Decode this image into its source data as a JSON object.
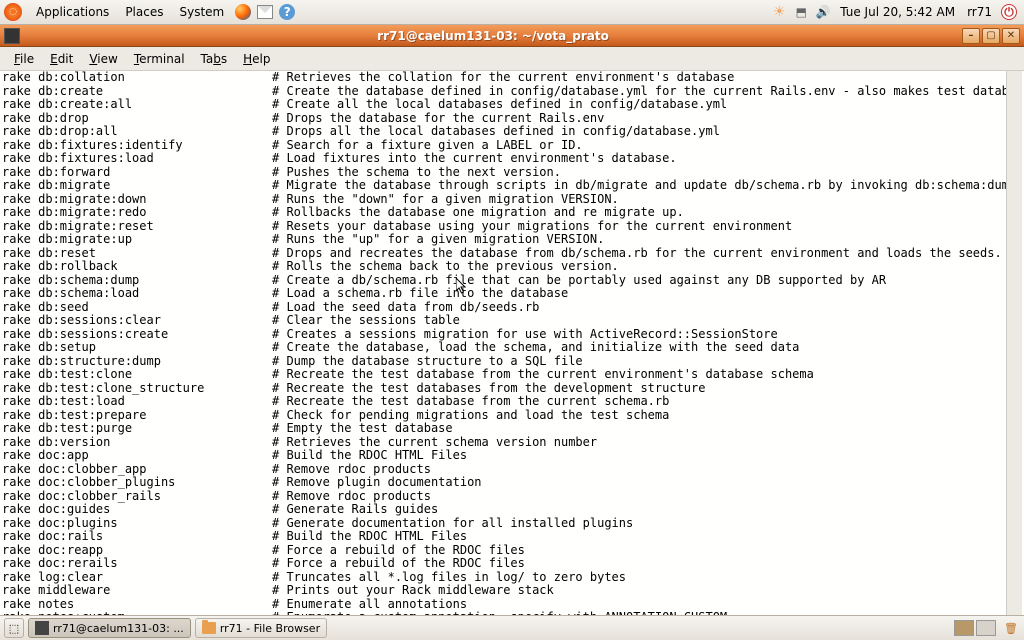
{
  "top_panel": {
    "menus": [
      "Applications",
      "Places",
      "System"
    ],
    "clock": "Tue Jul 20,  5:42 AM",
    "user": "rr71"
  },
  "window": {
    "title": "rr71@caelum131-03: ~/vota_prato",
    "menubar": [
      {
        "ul": "F",
        "rest": "ile"
      },
      {
        "ul": "E",
        "rest": "dit"
      },
      {
        "ul": "V",
        "rest": "iew"
      },
      {
        "ul": "T",
        "rest": "erminal"
      },
      {
        "ul": "",
        "rest": "Ta",
        "ul2": "b",
        "rest2": "s"
      },
      {
        "ul": "H",
        "rest": "elp"
      }
    ]
  },
  "terminal_lines": [
    {
      "cmd": "rake db:collation",
      "desc": "# Retrieves the collation for the current environment's database"
    },
    {
      "cmd": "rake db:create",
      "desc": "# Create the database defined in config/database.yml for the current Rails.env - also makes test database if i..."
    },
    {
      "cmd": "rake db:create:all",
      "desc": "# Create all the local databases defined in config/database.yml"
    },
    {
      "cmd": "rake db:drop",
      "desc": "# Drops the database for the current Rails.env"
    },
    {
      "cmd": "rake db:drop:all",
      "desc": "# Drops all the local databases defined in config/database.yml"
    },
    {
      "cmd": "rake db:fixtures:identify",
      "desc": "# Search for a fixture given a LABEL or ID."
    },
    {
      "cmd": "rake db:fixtures:load",
      "desc": "# Load fixtures into the current environment's database."
    },
    {
      "cmd": "rake db:forward",
      "desc": "# Pushes the schema to the next version."
    },
    {
      "cmd": "rake db:migrate",
      "desc": "# Migrate the database through scripts in db/migrate and update db/schema.rb by invoking db:schema:dump. Targe..."
    },
    {
      "cmd": "rake db:migrate:down",
      "desc": "# Runs the \"down\" for a given migration VERSION."
    },
    {
      "cmd": "rake db:migrate:redo",
      "desc": "# Rollbacks the database one migration and re migrate up."
    },
    {
      "cmd": "rake db:migrate:reset",
      "desc": "# Resets your database using your migrations for the current environment"
    },
    {
      "cmd": "rake db:migrate:up",
      "desc": "# Runs the \"up\" for a given migration VERSION."
    },
    {
      "cmd": "rake db:reset",
      "desc": "# Drops and recreates the database from db/schema.rb for the current environment and loads the seeds."
    },
    {
      "cmd": "rake db:rollback",
      "desc": "# Rolls the schema back to the previous version."
    },
    {
      "cmd": "rake db:schema:dump",
      "desc": "# Create a db/schema.rb file that can be portably used against any DB supported by AR"
    },
    {
      "cmd": "rake db:schema:load",
      "desc": "# Load a schema.rb file into the database"
    },
    {
      "cmd": "rake db:seed",
      "desc": "# Load the seed data from db/seeds.rb"
    },
    {
      "cmd": "rake db:sessions:clear",
      "desc": "# Clear the sessions table"
    },
    {
      "cmd": "rake db:sessions:create",
      "desc": "# Creates a sessions migration for use with ActiveRecord::SessionStore"
    },
    {
      "cmd": "rake db:setup",
      "desc": "# Create the database, load the schema, and initialize with the seed data"
    },
    {
      "cmd": "rake db:structure:dump",
      "desc": "# Dump the database structure to a SQL file"
    },
    {
      "cmd": "rake db:test:clone",
      "desc": "# Recreate the test database from the current environment's database schema"
    },
    {
      "cmd": "rake db:test:clone_structure",
      "desc": "# Recreate the test databases from the development structure"
    },
    {
      "cmd": "rake db:test:load",
      "desc": "# Recreate the test database from the current schema.rb"
    },
    {
      "cmd": "rake db:test:prepare",
      "desc": "# Check for pending migrations and load the test schema"
    },
    {
      "cmd": "rake db:test:purge",
      "desc": "# Empty the test database"
    },
    {
      "cmd": "rake db:version",
      "desc": "# Retrieves the current schema version number"
    },
    {
      "cmd": "rake doc:app",
      "desc": "# Build the RDOC HTML Files"
    },
    {
      "cmd": "rake doc:clobber_app",
      "desc": "# Remove rdoc products"
    },
    {
      "cmd": "rake doc:clobber_plugins",
      "desc": "# Remove plugin documentation"
    },
    {
      "cmd": "rake doc:clobber_rails",
      "desc": "# Remove rdoc products"
    },
    {
      "cmd": "rake doc:guides",
      "desc": "# Generate Rails guides"
    },
    {
      "cmd": "rake doc:plugins",
      "desc": "# Generate documentation for all installed plugins"
    },
    {
      "cmd": "rake doc:rails",
      "desc": "# Build the RDOC HTML Files"
    },
    {
      "cmd": "rake doc:reapp",
      "desc": "# Force a rebuild of the RDOC files"
    },
    {
      "cmd": "rake doc:rerails",
      "desc": "# Force a rebuild of the RDOC files"
    },
    {
      "cmd": "rake log:clear",
      "desc": "# Truncates all *.log files in log/ to zero bytes"
    },
    {
      "cmd": "rake middleware",
      "desc": "# Prints out your Rack middleware stack"
    },
    {
      "cmd": "rake notes",
      "desc": "# Enumerate all annotations"
    },
    {
      "cmd": "rake notes:custom",
      "desc": "# Enumerate a custom annotation, specify with ANNOTATION=CUSTOM"
    }
  ],
  "bottom_panel": {
    "tasks": [
      {
        "label": "rr71@caelum131-03: ...",
        "active": true,
        "icon": "terminal"
      },
      {
        "label": "rr71 - File Browser",
        "active": false,
        "icon": "folder"
      }
    ]
  }
}
